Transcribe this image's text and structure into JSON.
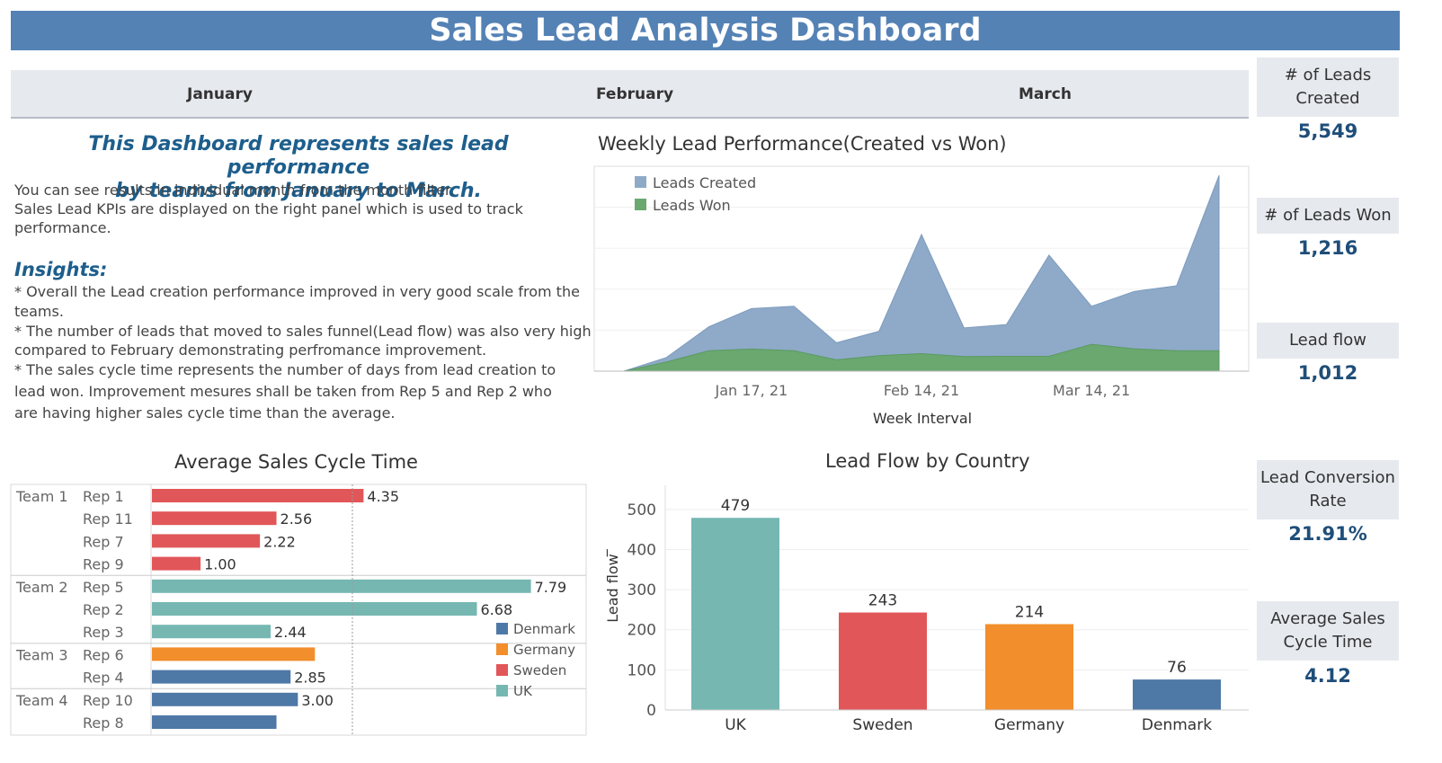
{
  "title": "Sales Lead Analysis Dashboard",
  "months": [
    "January",
    "February",
    "March"
  ],
  "kpis": [
    {
      "label": "# of Leads Created",
      "value": "5,549"
    },
    {
      "label": "# of  Leads Won",
      "value": "1,216"
    },
    {
      "label": "Lead flow",
      "value": "1,012"
    },
    {
      "label": "Lead Conversion Rate",
      "value": "21.91%"
    },
    {
      "label": "Average Sales Cycle Time",
      "value": "4.12"
    }
  ],
  "description": {
    "heading_line1": "This Dashboard represents sales lead performance",
    "heading_line2": "by teams  from January to March.",
    "lines": [
      "You can see results in individual month from the month filter.",
      "Sales Lead KPIs are displayed on the right panel which is used to track",
      "performance."
    ],
    "insights_heading": "Insights:",
    "insights": [
      "* Overall the Lead creation performance improved in very good scale from the",
      "teams.",
      "* The number of leads that moved to sales funnel(Lead flow) was also very high",
      "compared to February demonstrating perfromance improvement.",
      "* The sales cycle time represents the number of days from lead creation to",
      "lead won. Improvement mesures shall be taken from Rep 5 and Rep 2 who",
      "are having higher sales cycle time than the average."
    ]
  },
  "colors": {
    "header": "#5482b5",
    "created": "#8eaac8",
    "won": "#6aa870",
    "denmark": "#4e79a7",
    "germany": "#f28e2b",
    "sweden": "#e15759",
    "uk": "#76b7b2"
  },
  "chart_data": [
    {
      "type": "area",
      "title": "Weekly Lead Performance(Created vs Won)",
      "xlabel": "Week Interval",
      "ylabel": "",
      "x_tick_labels": [
        "Jan 17, 21",
        "Feb 14, 21",
        "Mar 14, 21"
      ],
      "x_tick_indices": [
        3,
        7,
        11
      ],
      "legend": [
        "Leads Created",
        "Leads Won"
      ],
      "legend_position": "top-left",
      "grid": true,
      "ylim": [
        0,
        900
      ],
      "weeks": 15,
      "series": [
        {
          "name": "Leads Created",
          "values": [
            0,
            60,
            195,
            275,
            285,
            125,
            175,
            600,
            190,
            205,
            510,
            285,
            350,
            375,
            860
          ]
        },
        {
          "name": "Leads Won",
          "values": [
            0,
            40,
            90,
            97,
            90,
            50,
            68,
            77,
            64,
            65,
            65,
            118,
            98,
            90,
            90
          ]
        }
      ]
    },
    {
      "type": "bar",
      "orientation": "horizontal",
      "title": "Average Sales Cycle Time",
      "reference_line": 4.12,
      "xlim": [
        0,
        8.5
      ],
      "rows": [
        {
          "team": "Team 1",
          "rep": "Rep 1",
          "value": 4.35,
          "label": "4.35",
          "country": "Sweden"
        },
        {
          "team": "",
          "rep": "Rep 11",
          "value": 2.56,
          "label": "2.56",
          "country": "Sweden"
        },
        {
          "team": "",
          "rep": "Rep 7",
          "value": 2.22,
          "label": "2.22",
          "country": "Sweden"
        },
        {
          "team": "",
          "rep": "Rep 9",
          "value": 1.0,
          "label": "1.00",
          "country": "Sweden"
        },
        {
          "team": "Team 2",
          "rep": "Rep 5",
          "value": 7.79,
          "label": "7.79",
          "country": "UK"
        },
        {
          "team": "",
          "rep": "Rep 2",
          "value": 6.68,
          "label": "6.68",
          "country": "UK"
        },
        {
          "team": "",
          "rep": "Rep 3",
          "value": 2.44,
          "label": "2.44",
          "country": "UK"
        },
        {
          "team": "Team 3",
          "rep": "Rep 6",
          "value": 3.35,
          "label": "",
          "country": "Germany"
        },
        {
          "team": "",
          "rep": "Rep 4",
          "value": 2.85,
          "label": "2.85",
          "country": "Denmark"
        },
        {
          "team": "Team 4",
          "rep": "Rep 10",
          "value": 3.0,
          "label": "3.00",
          "country": "Denmark"
        },
        {
          "team": "",
          "rep": "Rep 8",
          "value": 2.56,
          "label": "",
          "country": "Denmark"
        }
      ],
      "legend": [
        "Denmark",
        "Germany",
        "Sweden",
        "UK"
      ],
      "legend_position": "bottom-right"
    },
    {
      "type": "bar",
      "title": "Lead Flow by Country",
      "ylabel": "Lead flow ̅",
      "ylim": [
        0,
        540
      ],
      "y_ticks": [
        0,
        100,
        200,
        300,
        400,
        500
      ],
      "categories": [
        "UK",
        "Sweden",
        "Germany",
        "Denmark"
      ],
      "values": [
        479,
        243,
        214,
        76
      ],
      "grid": true
    }
  ]
}
